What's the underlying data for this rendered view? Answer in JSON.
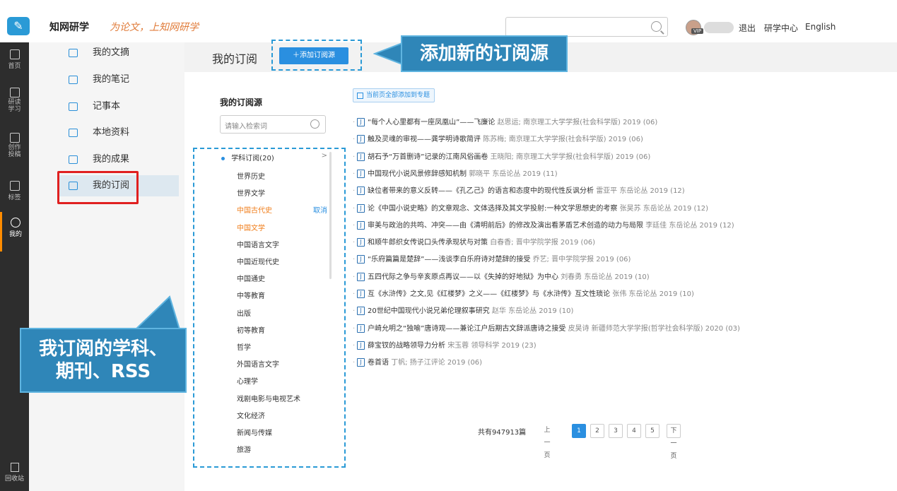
{
  "header": {
    "logo_icon": "cnki-logo-icon",
    "logo_text": "知网研学",
    "slogan": "为论文，上知网研学",
    "search_placeholder": "",
    "links": [
      "退出",
      "研学中心",
      "English"
    ],
    "vip_label": "VIP"
  },
  "narrow_nav": [
    {
      "icon": "home-icon",
      "label": "首页"
    },
    {
      "icon": "reading-icon",
      "label": "研读\n学习"
    },
    {
      "icon": "create-icon",
      "label": "创作\n投稿"
    },
    {
      "icon": "tag-icon",
      "label": "标签"
    },
    {
      "icon": "cube-icon",
      "label": "我的"
    },
    {
      "icon": "trash-icon",
      "label": "回收站"
    }
  ],
  "side_menu": [
    {
      "label": "我的文摘"
    },
    {
      "label": "我的笔记"
    },
    {
      "label": "记事本"
    },
    {
      "label": "本地资料"
    },
    {
      "label": "我的成果"
    },
    {
      "label": "我的订阅"
    }
  ],
  "main": {
    "page_title": "我的订阅",
    "add_button": "＋添加订阅源",
    "sources_title": "我的订阅源",
    "source_search_placeholder": "请输入检索词",
    "add_all_button": "当前页全部添加到专题",
    "tree_head": "学科订阅(20)",
    "tree_chevron": ">",
    "cancel_label": "取消",
    "tree_items": [
      "世界历史",
      "世界文学",
      "中国古代史",
      "中国文学",
      "中国语言文字",
      "中国近现代史",
      "中国通史",
      "中等教育",
      "出版",
      "初等教育",
      "哲学",
      "外国语言文字",
      "心理学",
      "戏剧电影与电视艺术",
      "文化经济",
      "新闻与传媒",
      "旅游"
    ],
    "articles": [
      {
        "title": "“每个人心里都有一座凤凰山”——飞廉论",
        "meta": "赵思运; 南京理工大学学报(社会科学版) 2019 (06)"
      },
      {
        "title": "触及灵魂的审视——龚学明诗歌简评",
        "meta": "陈苏梅; 南京理工大学学报(社会科学版) 2019 (06)"
      },
      {
        "title": "胡石予“万首删诗”记录的江南风俗画卷",
        "meta": "王晓阳; 南京理工大学学报(社会科学版) 2019 (06)"
      },
      {
        "title": "中国现代小说风景修辞感知机制",
        "meta": "郭晓平 东岳论丛 2019 (11)"
      },
      {
        "title": "缺位者带来的意义反转——《孔乙己》的语言和态度中的现代性反讽分析",
        "meta": "雷亚平 东岳论丛 2019 (12)"
      },
      {
        "title": "论《中国小说史略》的文章观念、文体选择及其文学投射:一种文学思想史的考察",
        "meta": "张昊苏 东岳论丛 2019 (12)"
      },
      {
        "title": "审美与政治的共鸣、冲突——由《清明前后》的修改及演出看茅盾艺术创造的动力与局限",
        "meta": "李廷佳 东岳论丛 2019 (12)"
      },
      {
        "title": "和顺牛郎织女传说口头传承现状与对策",
        "meta": "白春香; 晋中学院学报 2019 (06)"
      },
      {
        "title": "“乐府篇篇是楚辞”——浅谈李白乐府诗对楚辞的接受",
        "meta": "乔艺; 晋中学院学报 2019 (06)"
      },
      {
        "title": "五四代际之争与辛亥原点再议——以《失掉的好地狱》为中心",
        "meta": "刘春勇 东岳论丛 2019 (10)"
      },
      {
        "title": "互《水浒传》之文,见《红楼梦》之义——《红楼梦》与《水浒传》互文性琐论",
        "meta": "张伟 东岳论丛 2019 (10)"
      },
      {
        "title": "20世纪中国现代小说兄弟伦理叙事研究",
        "meta": "赵华 东岳论丛 2019 (10)"
      },
      {
        "title": "户崎允明之“独喻”唐诗观——兼论江户后期古文辞派唐诗之接受",
        "meta": "皮昊诗 新疆师范大学学报(哲学社会科学版) 2020 (03)"
      },
      {
        "title": "薛宝钗的战略领导力分析",
        "meta": "宋玉蓉 领导科学 2019 (23)"
      },
      {
        "title": "卷首语",
        "meta": "丁帆; 扬子江评论 2019 (06)"
      }
    ],
    "article_badge": "J",
    "pager": {
      "total": "共有947913篇",
      "prev": "上一页",
      "pages": [
        "1",
        "2",
        "3",
        "4",
        "5"
      ],
      "next": "下一页",
      "current": "1"
    }
  },
  "annotations": {
    "top_callout": "添加新的订阅源",
    "left_callout": "我订阅的学科、\n期刊、RSS"
  },
  "colors": {
    "accent": "#2a8fe0",
    "highlight": "#f07d1a",
    "nav_bg": "#2d2d2d",
    "callout_bg": "#2f86b8",
    "red_box": "#e02020"
  }
}
